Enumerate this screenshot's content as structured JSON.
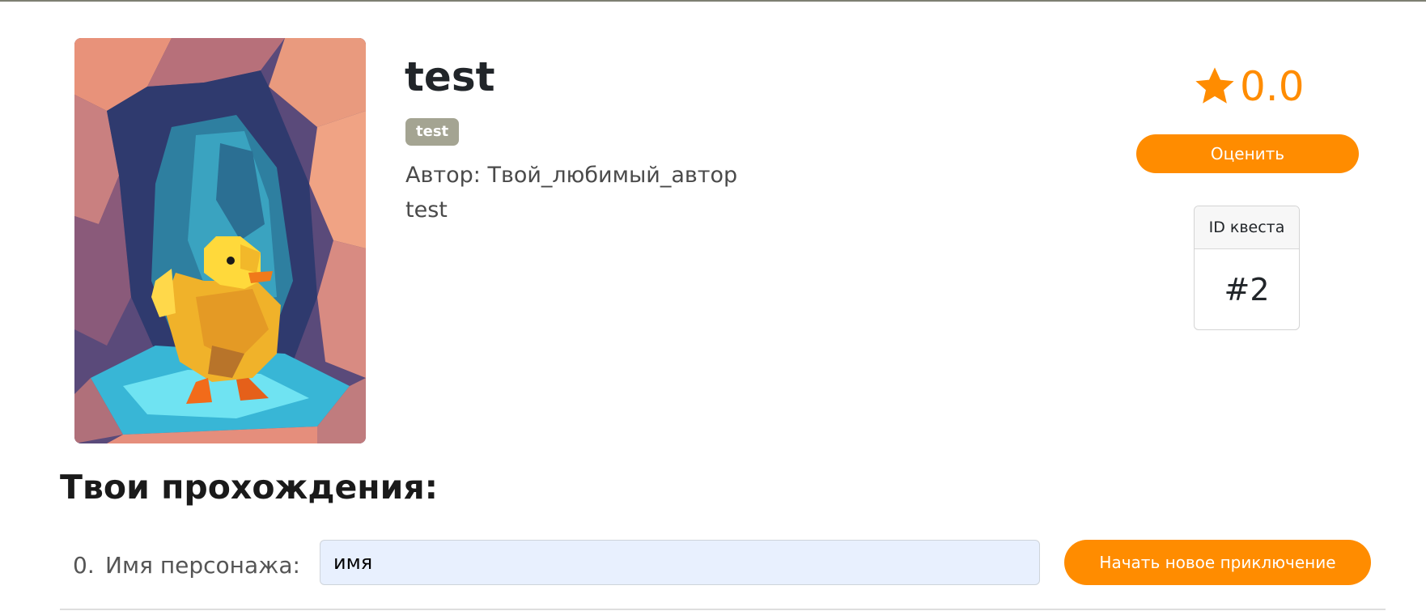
{
  "quest": {
    "title": "test",
    "tag": "test",
    "author_line": "Автор: Твой_любимый_автор",
    "description": "test",
    "cover_image": "low-poly yellow duck in a cave"
  },
  "rating": {
    "icon": "star-icon",
    "value": "0.0",
    "rate_button_label": "Оценить"
  },
  "quest_id_card": {
    "header": "ID квеста",
    "value": "#2"
  },
  "playthroughs": {
    "title": "Твои прохождения:",
    "new_run": {
      "index": "0.",
      "label": "Имя персонажа:",
      "input_value": "имя",
      "start_button_label": "Начать новое приключение"
    }
  },
  "colors": {
    "accent": "#ff8c00",
    "tag_bg": "#a4a492",
    "input_bg": "#e8f0fe",
    "top_border": "#7d7f72"
  }
}
